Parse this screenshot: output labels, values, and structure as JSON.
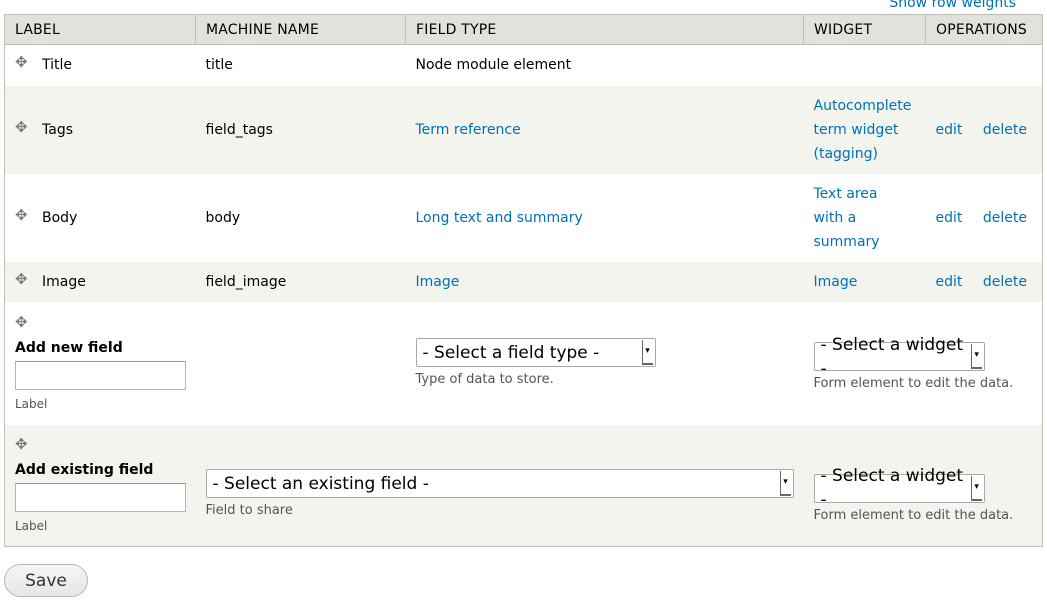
{
  "show_row_weights": "Show row weights",
  "columns": [
    "LABEL",
    "MACHINE NAME",
    "FIELD TYPE",
    "WIDGET",
    "OPERATIONS"
  ],
  "rows": [
    {
      "label": "Title",
      "machine_name": "title",
      "field_type": "Node module element",
      "widget": [],
      "edit": "",
      "delete": ""
    },
    {
      "label": "Tags",
      "machine_name": "field_tags",
      "field_type": "Term reference",
      "widget": [
        "Autocomplete",
        "term widget",
        "(tagging)"
      ],
      "edit": "edit",
      "delete": "delete"
    },
    {
      "label": "Body",
      "machine_name": "body",
      "field_type": "Long text and summary",
      "widget": [
        "Text area",
        "with a",
        "summary"
      ],
      "edit": "edit",
      "delete": "delete"
    },
    {
      "label": "Image",
      "machine_name": "field_image",
      "field_type": "Image",
      "widget": [
        "Image"
      ],
      "edit": "edit",
      "delete": "delete"
    }
  ],
  "add_new": {
    "title": "Add new field",
    "label_value": "",
    "label_caption": "Label",
    "field_type_select": "- Select a field type -",
    "field_type_desc": "Type of data to store.",
    "widget_select": "- Select a widget -",
    "widget_desc": "Form element to edit the data."
  },
  "add_existing": {
    "title": "Add existing field",
    "label_value": "",
    "label_caption": "Label",
    "existing_select": "- Select an existing field -",
    "existing_desc": "Field to share",
    "widget_select": "- Select a widget -",
    "widget_desc": "Form element to edit the data."
  },
  "save_label": "Save",
  "icons": {
    "drag": "move-handle-icon",
    "select_arrow": "dropdown-arrow-icon"
  },
  "colors": {
    "link": "#0071b3",
    "header_bg": "#e1e2dc",
    "even_row_bg": "#f3f4ee",
    "border": "#bfbfba"
  }
}
